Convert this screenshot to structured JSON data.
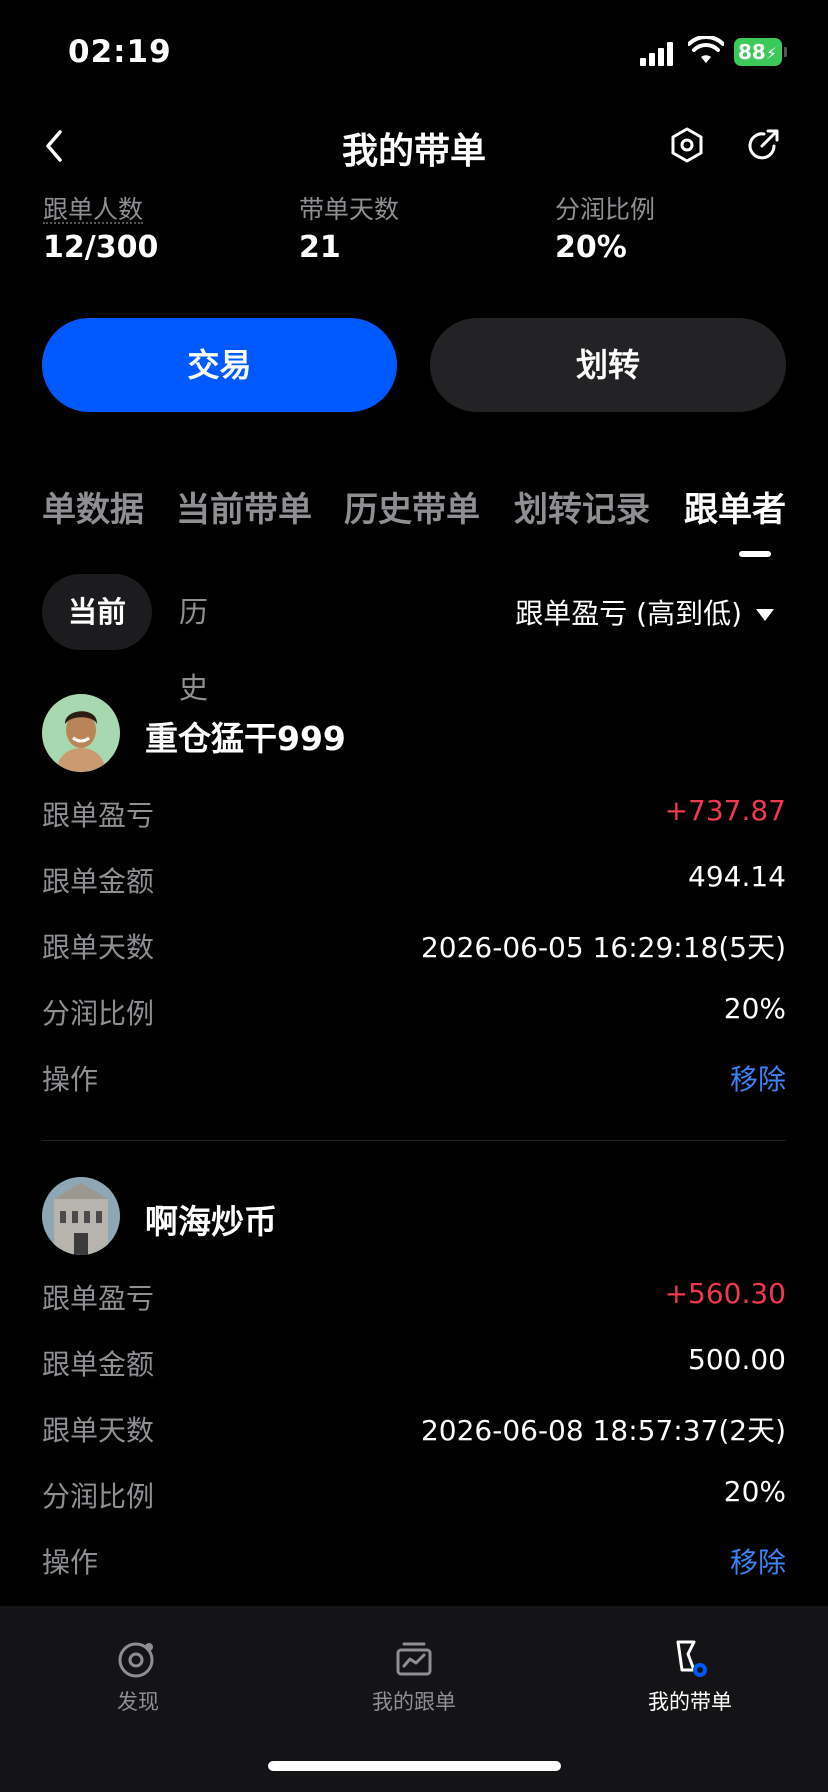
{
  "status_bar": {
    "time": "02:19",
    "battery": "88"
  },
  "nav": {
    "title": "我的带单"
  },
  "stats": [
    {
      "label": "跟单人数",
      "value": "12/300"
    },
    {
      "label": "带单天数",
      "value": "21"
    },
    {
      "label": "分润比例",
      "value": "20%"
    }
  ],
  "actions": {
    "trade": "交易",
    "transfer": "划转"
  },
  "tabs": [
    "单数据",
    "当前带单",
    "历史带单",
    "划转记录",
    "跟单者"
  ],
  "segment": {
    "current": "当前",
    "history": "历史",
    "sort": "跟单盈亏 (高到低)"
  },
  "followers": [
    {
      "name": "重仓猛干999",
      "rows": [
        {
          "label": "跟单盈亏",
          "value": "+737.87"
        },
        {
          "label": "跟单金额",
          "value": "494.14"
        },
        {
          "label": "跟单天数",
          "value": "2026-06-05 16:29:18(5天)"
        },
        {
          "label": "分润比例",
          "value": "20%"
        },
        {
          "label": "操作",
          "value": "移除"
        }
      ]
    },
    {
      "name": "啊海炒币",
      "rows": [
        {
          "label": "跟单盈亏",
          "value": "+560.30"
        },
        {
          "label": "跟单金额",
          "value": "500.00"
        },
        {
          "label": "跟单天数",
          "value": "2026-06-08 18:57:37(2天)"
        },
        {
          "label": "分润比例",
          "value": "20%"
        },
        {
          "label": "操作",
          "value": "移除"
        }
      ]
    }
  ],
  "tabbar": [
    {
      "label": "发现",
      "icon": "discover-icon"
    },
    {
      "label": "我的跟单",
      "icon": "copy-trade-icon"
    },
    {
      "label": "我的带单",
      "icon": "lead-trade-icon"
    }
  ],
  "colors": {
    "accent": "#0059ff",
    "profit": "#f0384f",
    "link": "#3b82f6",
    "battery": "#3dc85a"
  }
}
